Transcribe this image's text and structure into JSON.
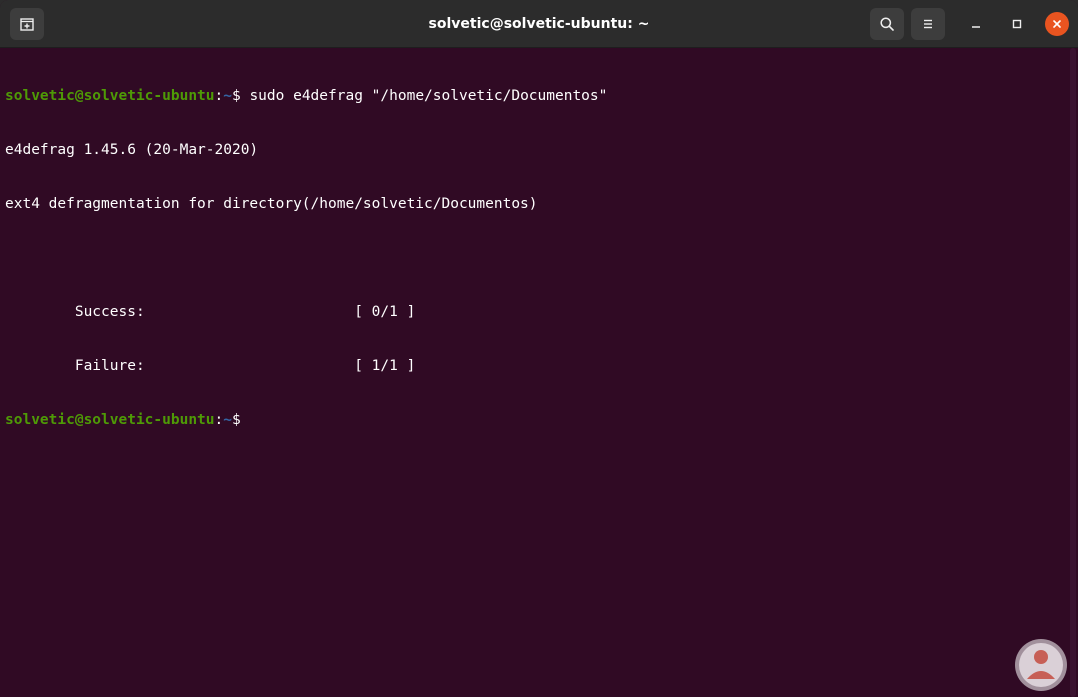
{
  "window": {
    "title": "solvetic@solvetic-ubuntu: ~"
  },
  "icons": {
    "new_tab": "new-tab-icon",
    "search": "search-icon",
    "menu": "hamburger-menu-icon",
    "minimize": "minimize-icon",
    "maximize": "maximize-icon",
    "close": "close-icon",
    "watermark": "solvetic-logo-icon"
  },
  "colors": {
    "terminal_bg": "#300a24",
    "prompt_user": "#4e9a06",
    "prompt_path": "#3465a4",
    "close_button": "#e95420",
    "titlebar": "#2c2c2c"
  },
  "terminal": {
    "prompt_user": "solvetic@solvetic-ubuntu",
    "prompt_colon": ":",
    "prompt_path": "~",
    "prompt_symbol": "$ ",
    "command": "sudo e4defrag \"/home/solvetic/Documentos\"",
    "output": [
      "e4defrag 1.45.6 (20-Mar-2020)",
      "ext4 defragmentation for directory(/home/solvetic/Documentos)",
      "",
      "        Success:                        [ 0/1 ]",
      "        Failure:                        [ 1/1 ]"
    ]
  }
}
